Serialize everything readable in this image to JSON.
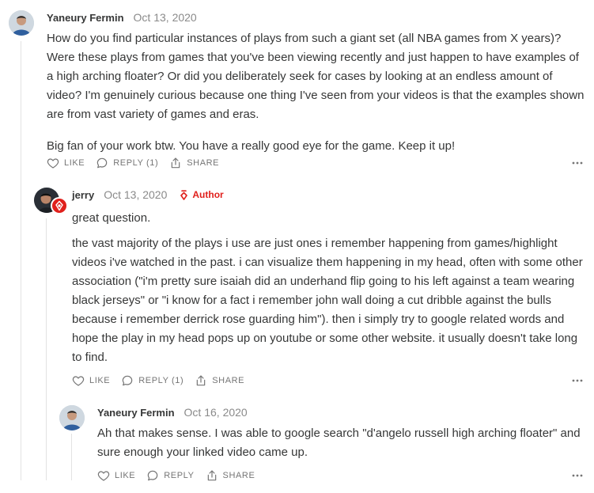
{
  "comments": [
    {
      "author": "Yaneury Fermin",
      "date": "Oct 13, 2020",
      "paragraphs": [
        "How do you find particular instances of plays from such a giant set (all NBA games from X years)? Were these plays from games that you've been viewing recently and just happen to have examples of a high arching floater? Or did you deliberately seek for cases by looking at an endless amount of video? I'm genuinely curious because one thing I've seen from your videos is that the examples shown are from vast variety of games and eras.",
        "Big fan of your work btw. You have a really good eye for the game. Keep it up!"
      ],
      "like_label": "LIKE",
      "reply_label": "REPLY (1)",
      "share_label": "SHARE"
    },
    {
      "author": "jerry",
      "date": "Oct 13, 2020",
      "badge": "Author",
      "paragraphs": [
        "great question.",
        "the vast majority of the plays i use are just ones i remember happening from games/highlight videos i've watched in the past. i can visualize them happening in my head, often with some other association (\"i'm pretty sure isaiah did an underhand flip going to his left against a team wearing black jerseys\" or \"i know for a fact i remember john wall doing a cut dribble against the bulls because i remember derrick rose guarding him\"). then i simply try to google related words and hope the play in my head pops up on youtube or some other website. it usually doesn't take long to find."
      ],
      "like_label": "LIKE",
      "reply_label": "REPLY (1)",
      "share_label": "SHARE"
    },
    {
      "author": "Yaneury Fermin",
      "date": "Oct 16, 2020",
      "paragraphs": [
        "Ah that makes sense. I was able to google search \"d'angelo russell high arching floater\" and sure enough your linked video came up."
      ],
      "like_label": "LIKE",
      "reply_label": "REPLY",
      "share_label": "SHARE"
    }
  ],
  "icons": {
    "like": "heart-icon",
    "reply": "speech-bubble-icon",
    "share": "share-icon",
    "more": "ellipsis-icon",
    "author": "pen-nib-icon"
  },
  "colors": {
    "author_accent": "#e0201c",
    "muted": "#757575",
    "text": "#363737"
  }
}
